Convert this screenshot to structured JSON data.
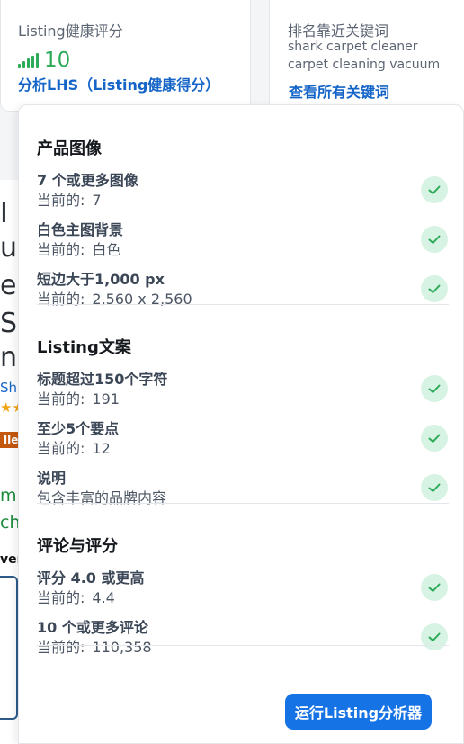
{
  "lhs_card": {
    "title": "Listing健康评分",
    "score": "10",
    "link": "分析LHS（Listing健康得分）",
    "score_color": "#2eab5a"
  },
  "keywords_card": {
    "title": "排名靠近关键词",
    "keywords": [
      "shark carpet cleaner",
      "carpet cleaning vacuum"
    ],
    "link": "查看所有关键词"
  },
  "background_page": {
    "fragments": [
      "I N",
      "un",
      "el",
      "S,",
      "nd",
      "Sha",
      "★★",
      "ller",
      "m",
      "ch",
      "ver"
    ]
  },
  "checklist": {
    "current_label": "当前的:",
    "sections": [
      {
        "title": "产品图像",
        "items": [
          {
            "label": "7 个或更多图像",
            "value": "7",
            "passed": true
          },
          {
            "label": "白色主图背景",
            "value": "白色",
            "passed": true
          },
          {
            "label": "短边大于1,000 px",
            "value": "2,560 x 2,560",
            "passed": true
          }
        ]
      },
      {
        "title": "Listing文案",
        "items": [
          {
            "label": "标题超过150个字符",
            "value": "191",
            "passed": true
          },
          {
            "label": "至少5个要点",
            "value": "12",
            "passed": true
          },
          {
            "label": "说明",
            "value": "包含丰富的品牌内容",
            "passed": true
          }
        ]
      },
      {
        "title": "评论与评分",
        "items": [
          {
            "label": "评分 4.0 或更高",
            "value": "4.4",
            "passed": true
          },
          {
            "label": "10 个或更多评论",
            "value": "110,358",
            "passed": true
          }
        ]
      }
    ],
    "run_button": "运行Listing分析器",
    "accent_color": "#1673e6",
    "check_color": "#2eab5a"
  }
}
